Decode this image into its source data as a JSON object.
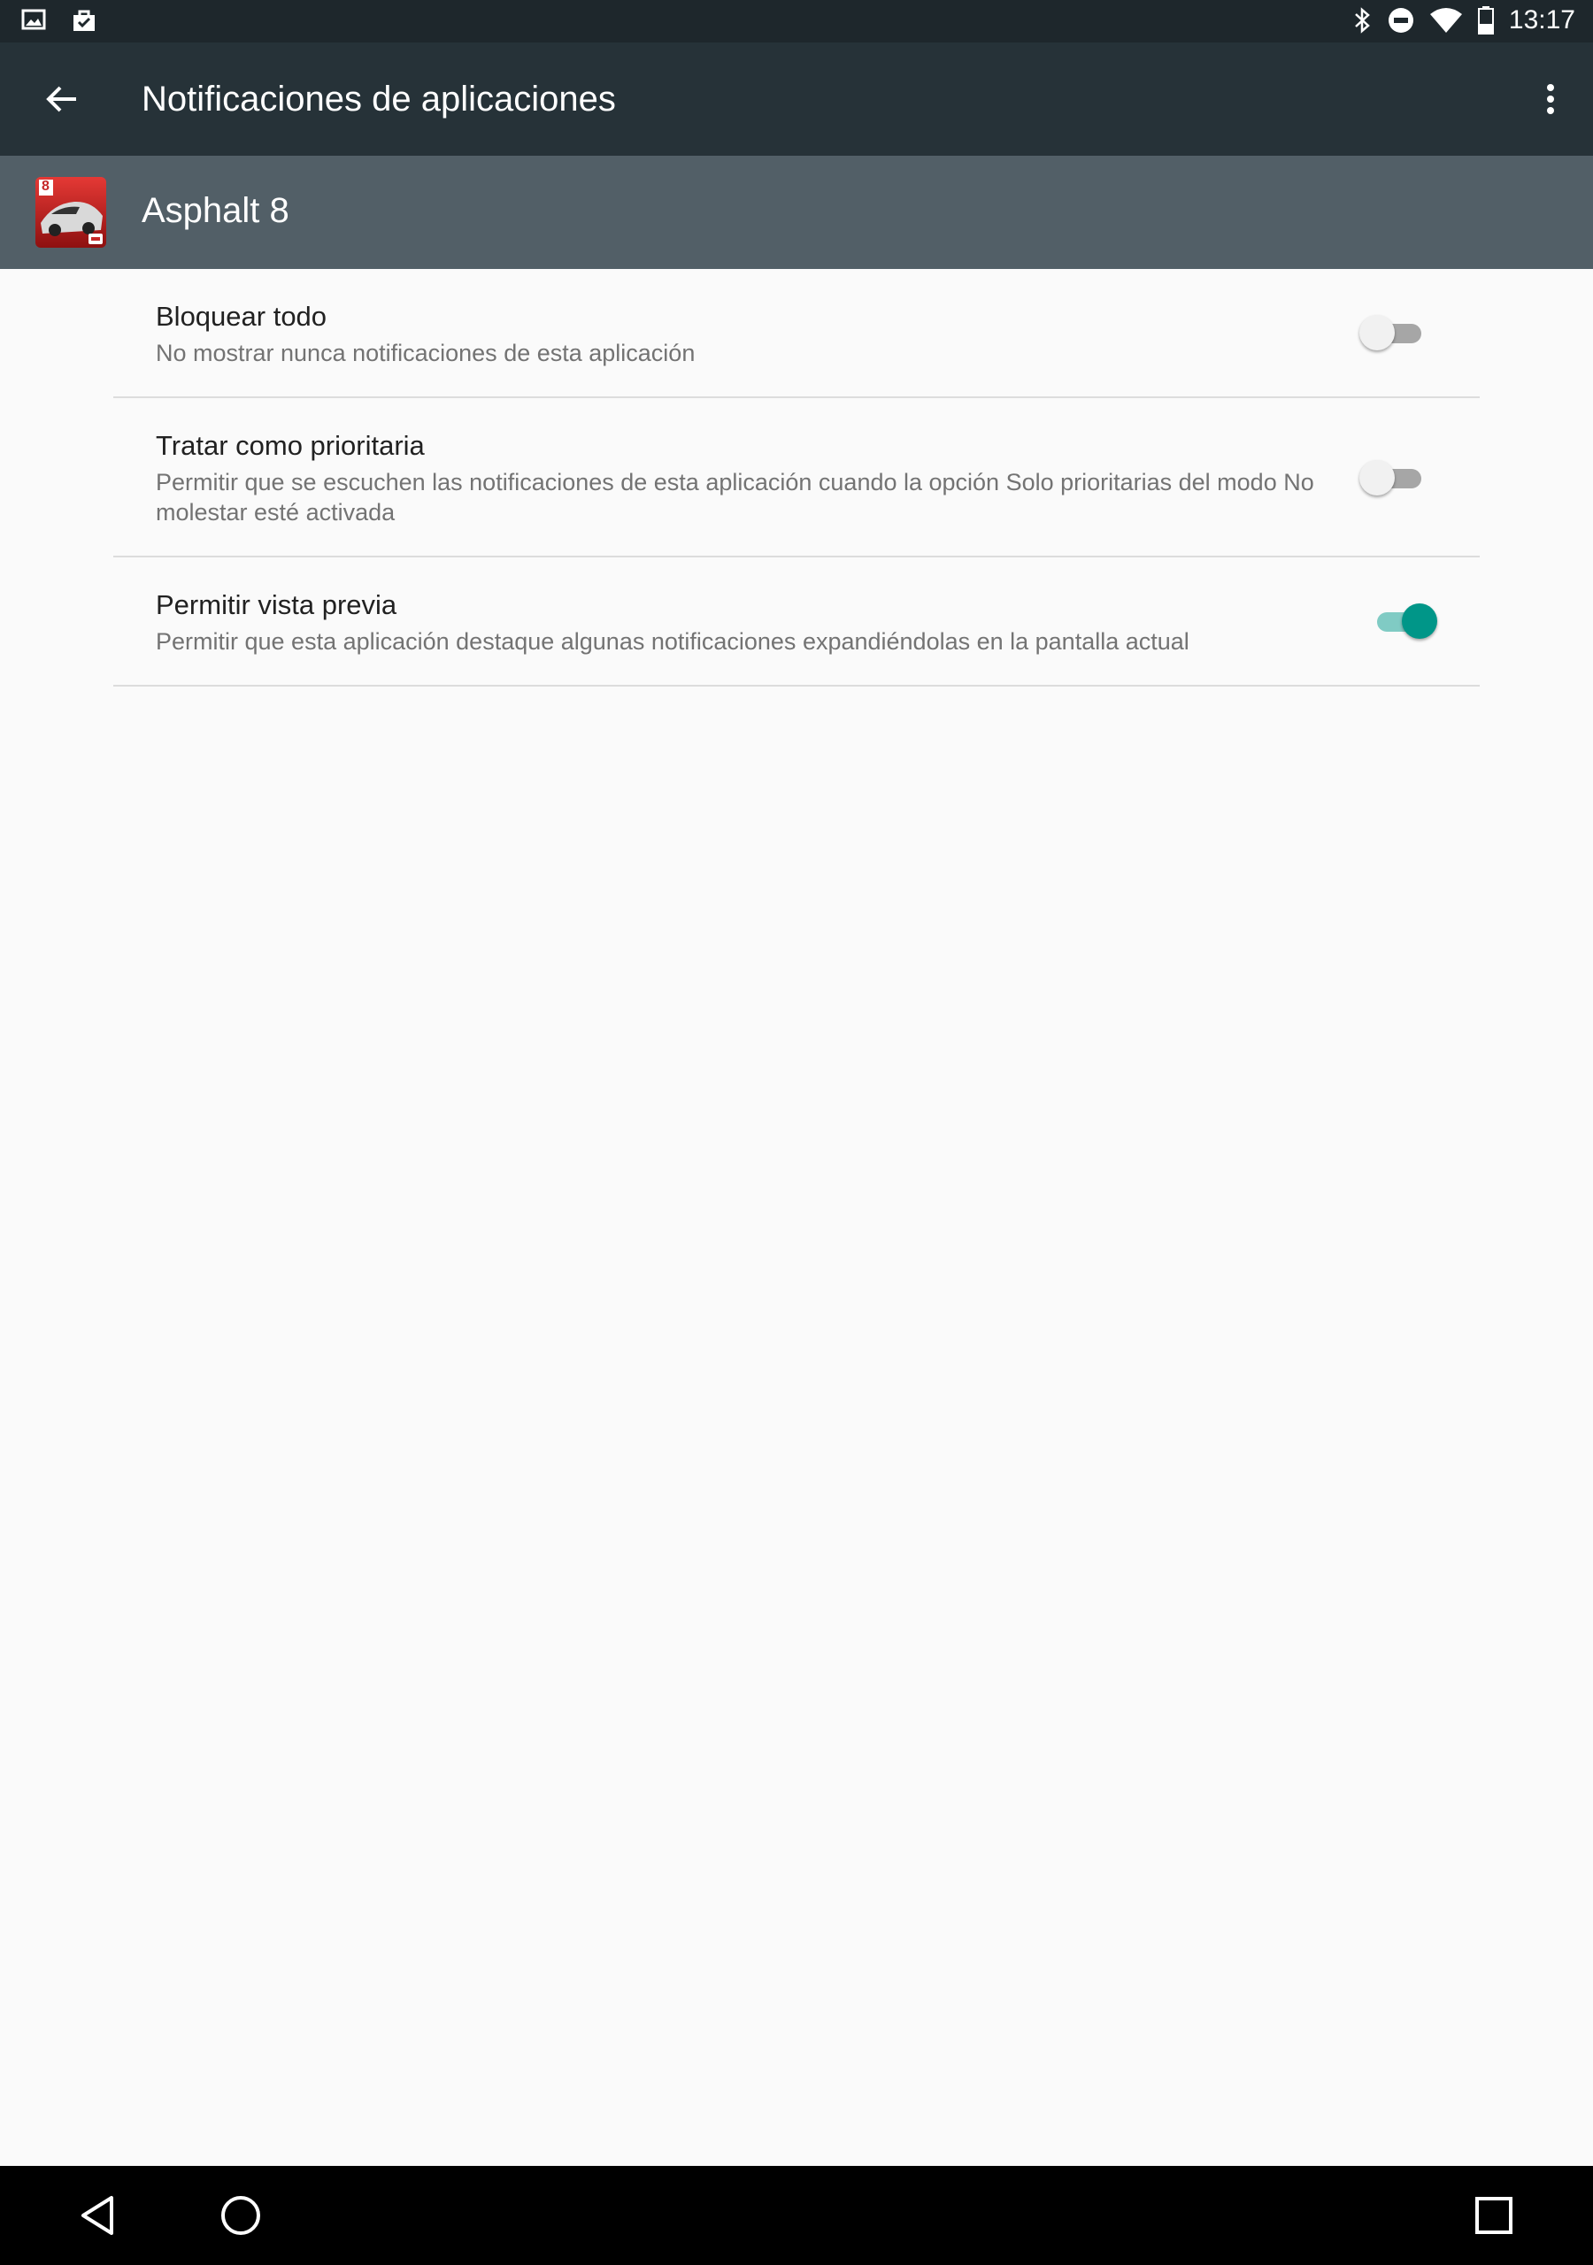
{
  "status_bar": {
    "left_icons": [
      "image-icon",
      "shopping-bag-icon"
    ],
    "right_icons": [
      "bluetooth-icon",
      "do-not-disturb-icon",
      "wifi-icon",
      "battery-icon"
    ],
    "time": "13:17"
  },
  "app_bar": {
    "title": "Notificaciones de aplicaciones",
    "back_icon": "arrow-left-icon",
    "overflow_icon": "more-vert-icon"
  },
  "app_header": {
    "name": "Asphalt 8",
    "icon": "asphalt-8-icon",
    "icon_badge": "8"
  },
  "settings": [
    {
      "title": "Bloquear todo",
      "summary": "No mostrar nunca notificaciones de esta aplicación",
      "enabled": false
    },
    {
      "title": "Tratar como prioritaria",
      "summary": "Permitir que se escuchen las notificaciones de esta aplicación cuando la opción Solo prioritarias del modo No molestar esté activada",
      "enabled": false
    },
    {
      "title": "Permitir vista previa",
      "summary": "Permitir que esta aplicación destaque algunas notificaciones expandiéndolas en la pantalla actual",
      "enabled": true
    }
  ],
  "nav_bar": {
    "buttons": [
      "back-triangle-icon",
      "home-circle-icon",
      "recents-square-icon"
    ]
  },
  "colors": {
    "status_bar": "#1e272c",
    "app_bar": "#263238",
    "app_header": "#525f67",
    "accent": "#009688"
  }
}
